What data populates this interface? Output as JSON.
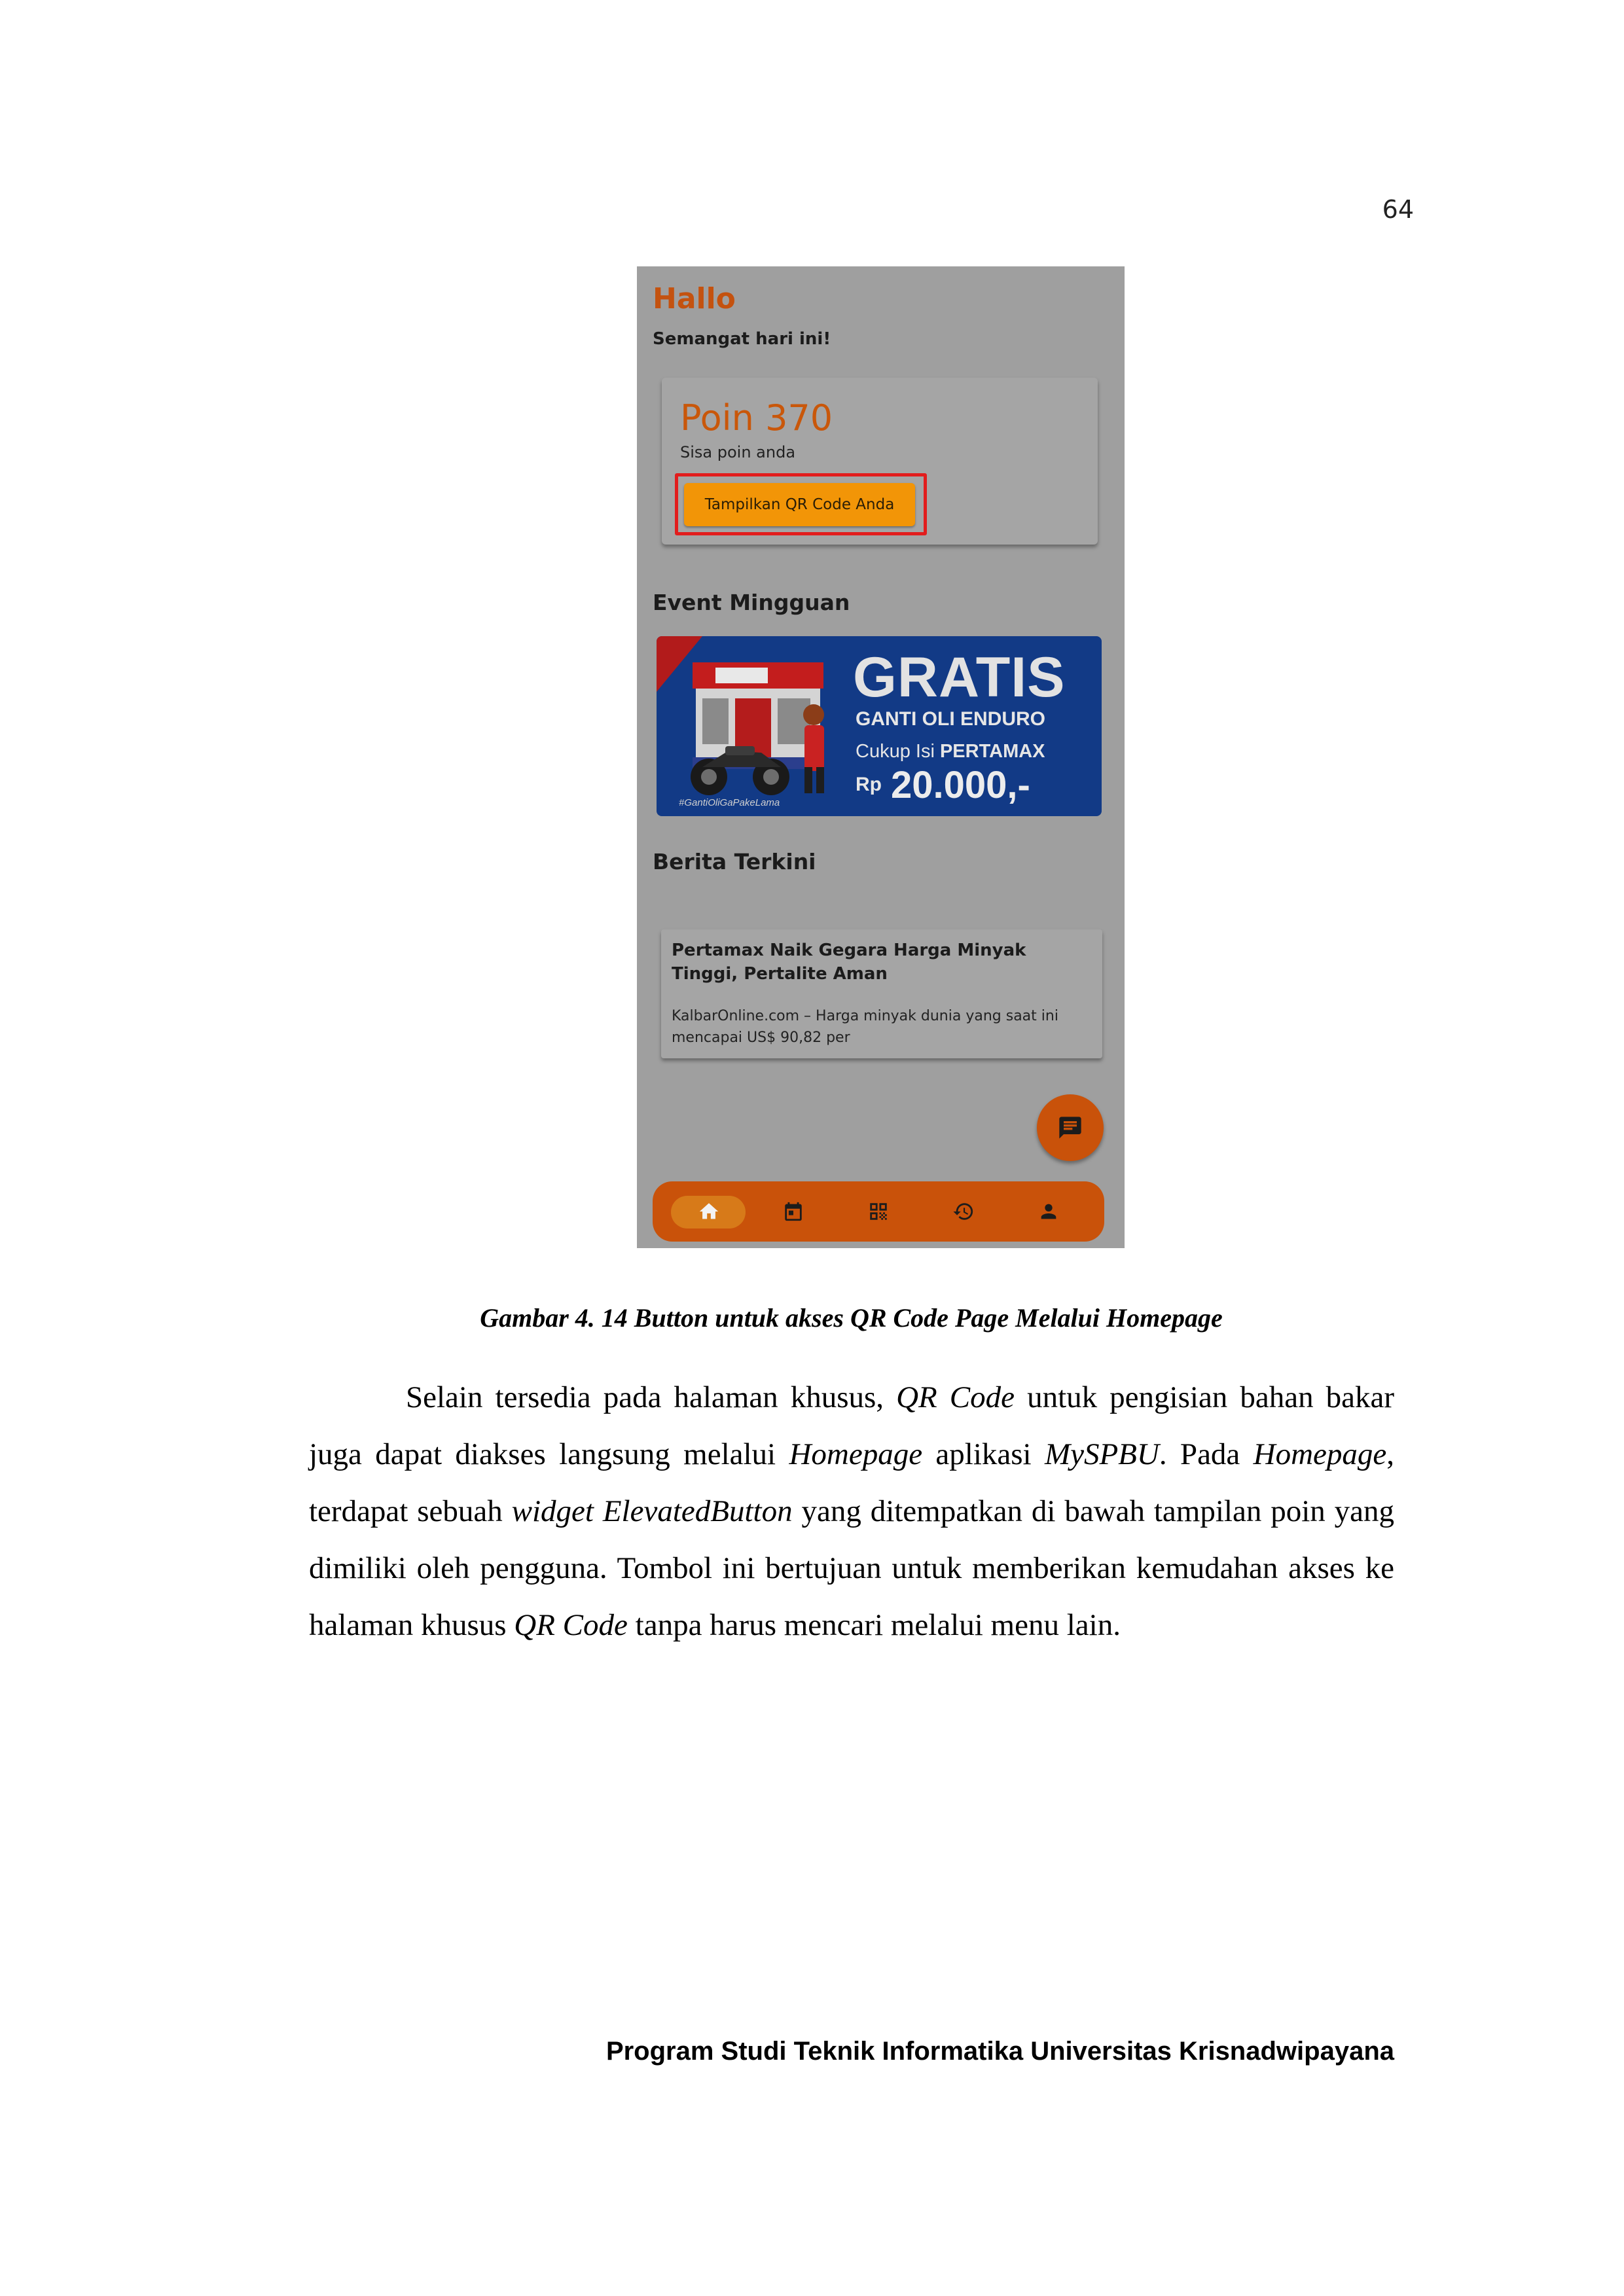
{
  "page_number": "64",
  "screenshot": {
    "greeting": "Hallo",
    "subtitle": "Semangat hari ini!",
    "points_card": {
      "title": "Poin 370",
      "subtitle": "Sisa poin anda",
      "qr_button_label": "Tampilkan QR Code Anda",
      "highlight_color": "#e21d1d"
    },
    "event_section_title": "Event Mingguan",
    "banner": {
      "headline": "GRATIS",
      "line1": "GANTI OLI ENDURO",
      "line2_prefix": "Cukup Isi ",
      "line2_bold": "PERTAMAX",
      "currency": "Rp",
      "amount": "20.000,-",
      "hashtag": "#GantiOliGaPakeLama"
    },
    "news_section_title": "Berita Terkini",
    "news_card": {
      "title": "Pertamax Naik Gegara Harga Minyak Tinggi, Pertalite Aman",
      "excerpt": "KalbarOnline.com – Harga minyak dunia yang saat ini mencapai US$ 90,82 per"
    },
    "fab_icon": "chat-icon",
    "bottom_nav": [
      "home-icon",
      "calendar-icon",
      "qr-code-icon",
      "history-icon",
      "person-icon"
    ],
    "accent_color": "#c9520a"
  },
  "caption": "Gambar 4. 14 Button untuk akses QR Code Page Melalui Homepage",
  "body": {
    "t1": "Selain tersedia pada halaman khusus, ",
    "i1": "QR Code",
    "t2": " untuk pengisian bahan bakar juga dapat diakses langsung melalui ",
    "i2": "Homepage",
    "t3": " aplikasi ",
    "i3": "MySPBU",
    "t4": ". Pada ",
    "i4": "Homepage",
    "t5": ", terdapat sebuah ",
    "i5": "widget ElevatedButton",
    "t6": " yang ditempatkan di bawah tampilan poin yang dimiliki oleh pengguna. Tombol ini bertujuan untuk memberikan kemudahan akses ke halaman khusus ",
    "i6": "QR Code",
    "t7": " tanpa harus mencari melalui menu lain."
  },
  "footer": "Program Studi Teknik Informatika Universitas Krisnadwipayana"
}
